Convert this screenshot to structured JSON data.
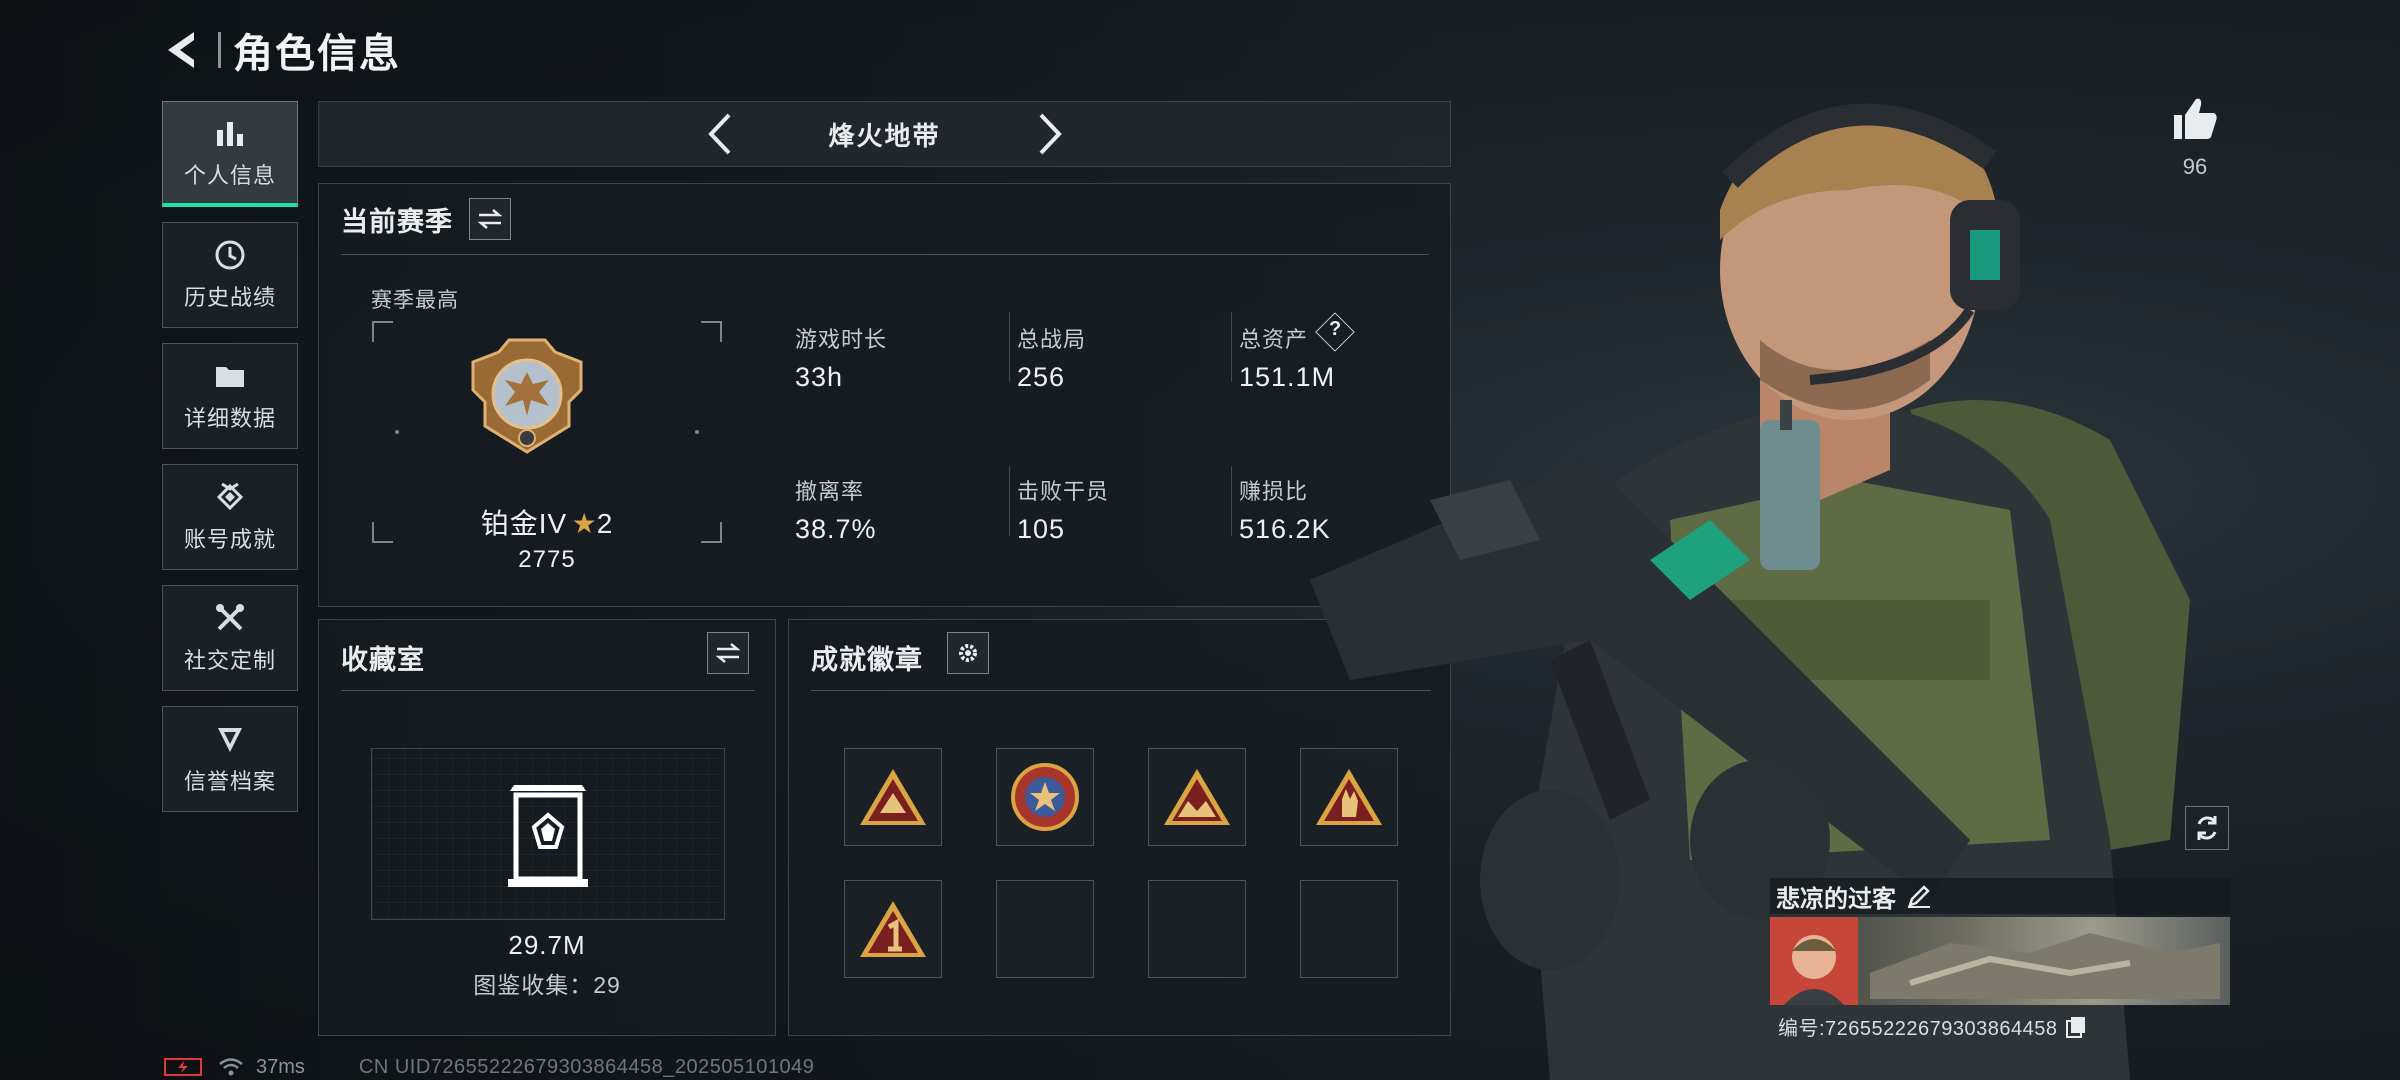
{
  "header": {
    "title": "角色信息"
  },
  "nav": {
    "items": [
      {
        "label": "个人信息",
        "icon": "bar-chart-icon",
        "active": true
      },
      {
        "label": "历史战绩",
        "icon": "clock-icon",
        "active": false
      },
      {
        "label": "详细数据",
        "icon": "folder-icon",
        "active": false
      },
      {
        "label": "账号成就",
        "icon": "achievement-icon",
        "active": false
      },
      {
        "label": "社交定制",
        "icon": "wrench-icon",
        "active": false
      },
      {
        "label": "信誉档案",
        "icon": "shield-icon",
        "active": false
      }
    ]
  },
  "mode": {
    "label": "烽火地带"
  },
  "season": {
    "title": "当前赛季",
    "best_label": "赛季最高",
    "rank_name": "铂金IV",
    "rank_stars": "2",
    "rank_score": "2775",
    "stats": [
      {
        "label": "游戏时长",
        "value": "33h"
      },
      {
        "label": "总战局",
        "value": "256"
      },
      {
        "label": "总资产",
        "value": "151.1M"
      },
      {
        "label": "撤离率",
        "value": "38.7%"
      },
      {
        "label": "击败干员",
        "value": "105"
      },
      {
        "label": "赚损比",
        "value": "516.2K"
      }
    ],
    "help": "?"
  },
  "collection": {
    "title": "收藏室",
    "value": "29.7M",
    "count_text": "图鉴收集：29"
  },
  "achievements": {
    "title": "成就徽章",
    "badge_slots": 8,
    "filled": 5
  },
  "likes": {
    "count": "96"
  },
  "player": {
    "name": "悲凉的过客",
    "id_text": "编号:7265522267930386445​8"
  },
  "status": {
    "ping": "37ms",
    "uid_text": "CN UID7265522267930386445​8_202505101049"
  },
  "colors": {
    "accent": "#1fe0a6",
    "battery": "#e23a3a",
    "gold": "#d9a441"
  }
}
